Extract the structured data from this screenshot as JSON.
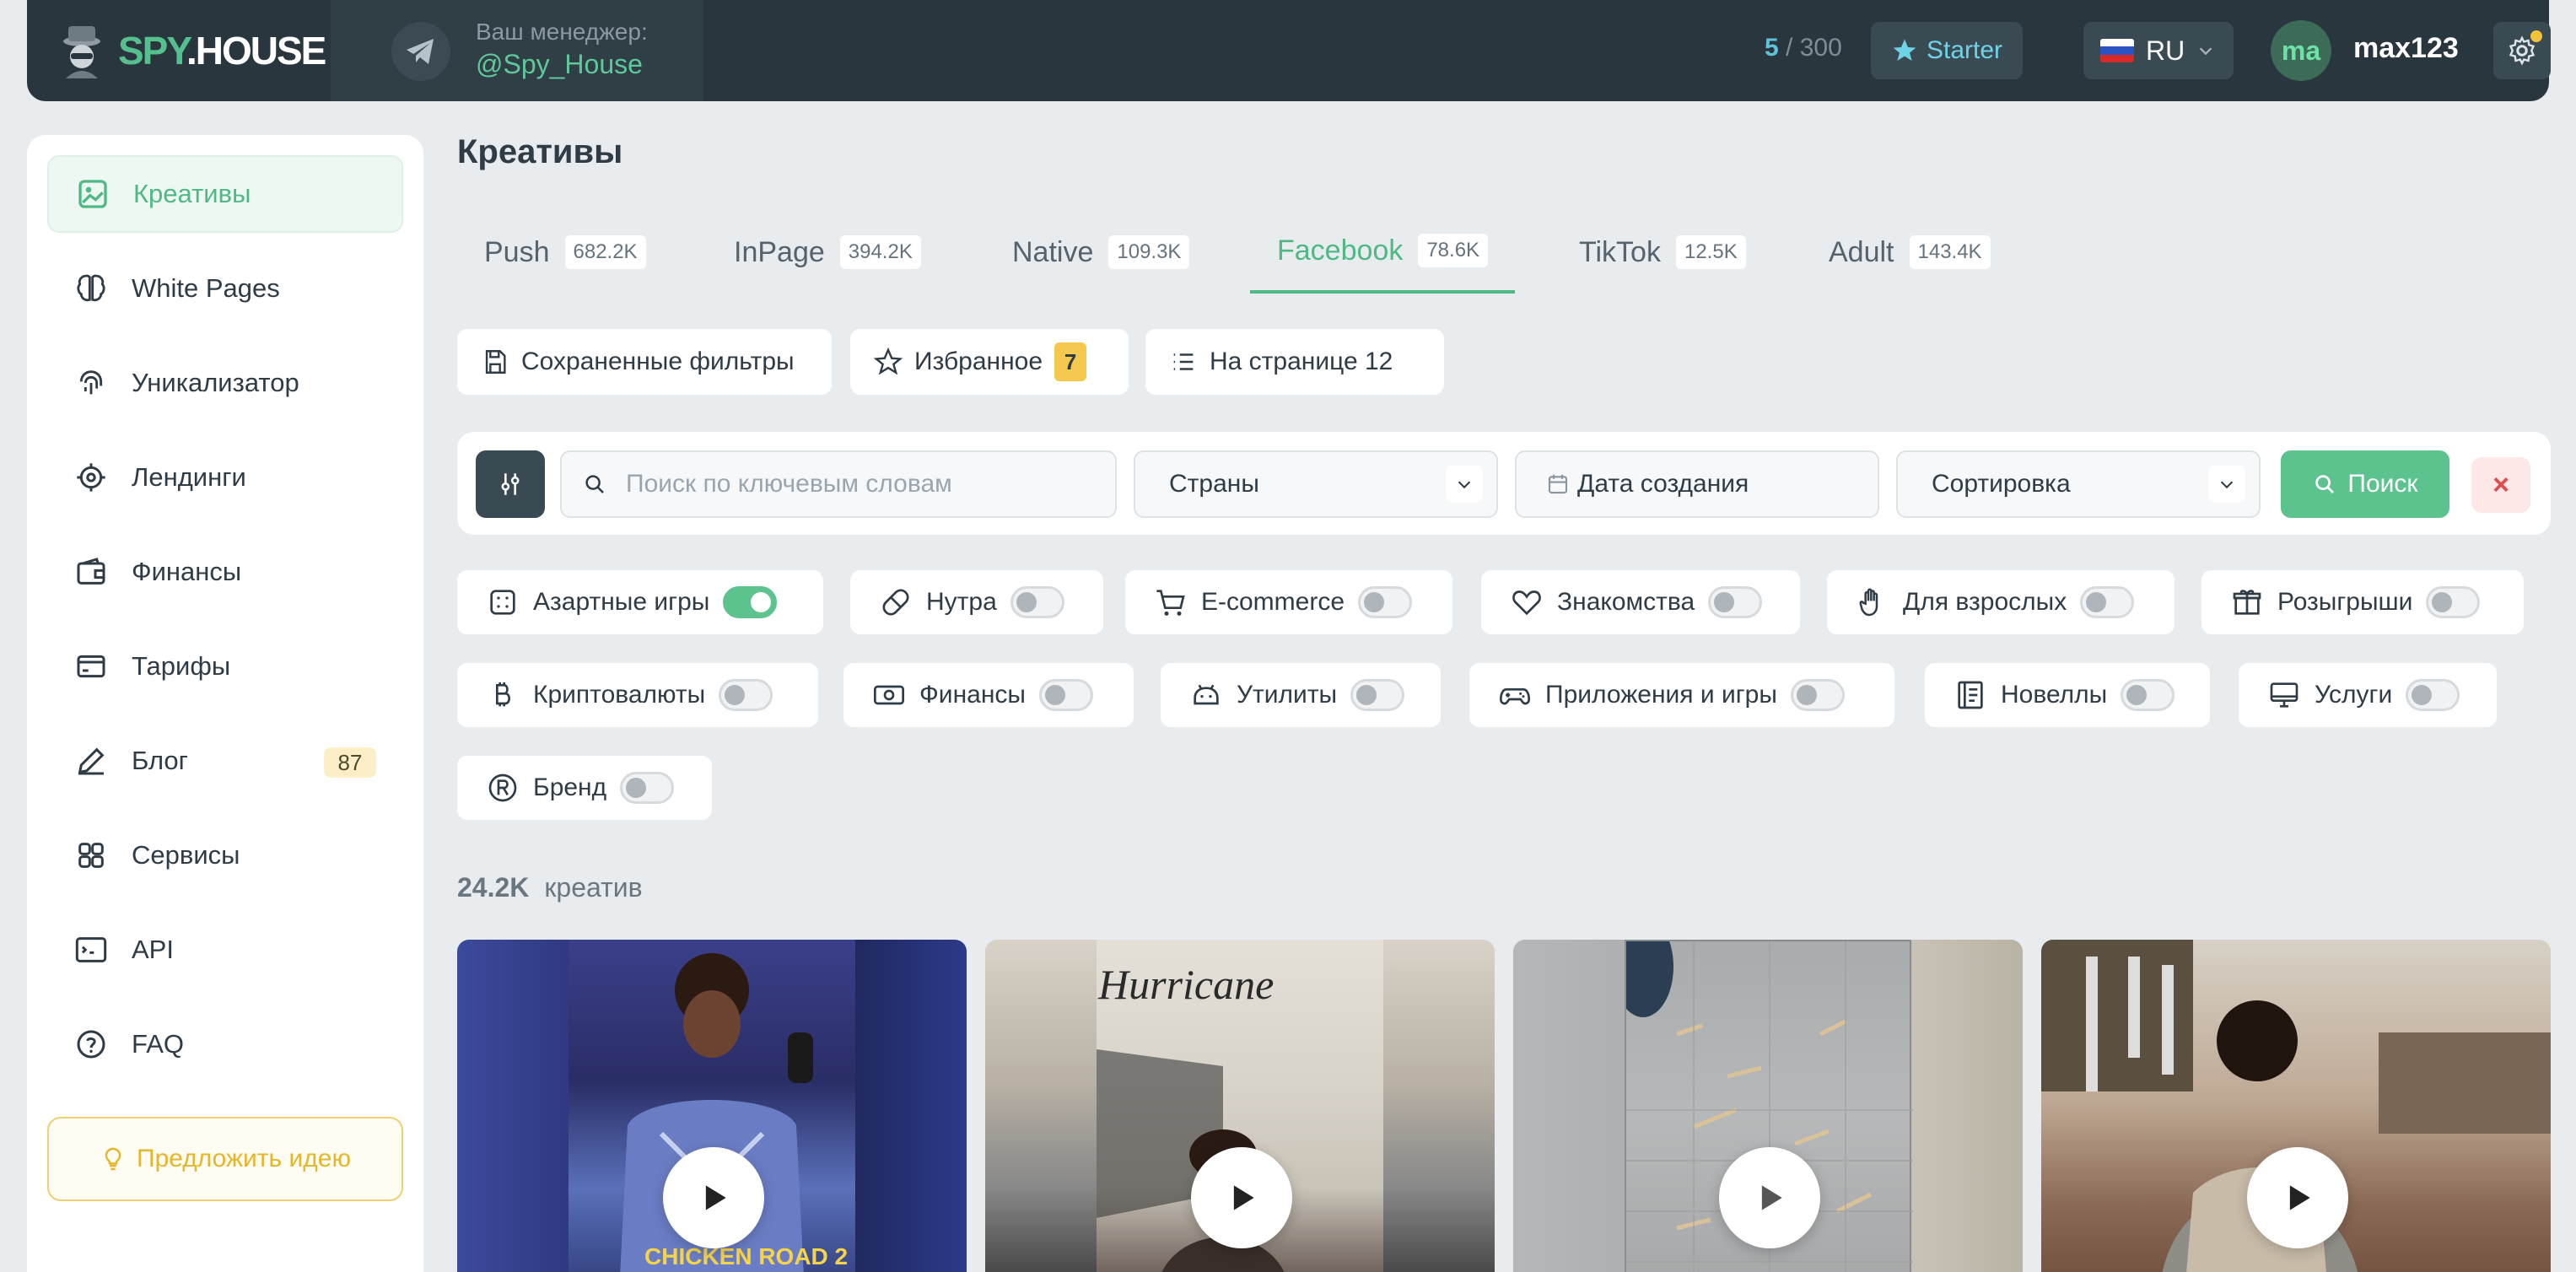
{
  "header": {
    "logo_text_accent": "SPY",
    "logo_text_rest": ".HOUSE",
    "manager_label": "Ваш менеджер:",
    "manager_handle": "@Spy_House",
    "counter_used": "5",
    "counter_total": "/ 300",
    "plan_label": "Starter",
    "language": "RU",
    "avatar_initials": "ma",
    "username": "max123"
  },
  "sidebar": {
    "items": [
      {
        "label": "Креативы",
        "icon": "image-icon"
      },
      {
        "label": "White Pages",
        "icon": "brain-icon"
      },
      {
        "label": "Уникализатор",
        "icon": "fingerprint-icon"
      },
      {
        "label": "Лендинги",
        "icon": "target-icon"
      },
      {
        "label": "Финансы",
        "icon": "wallet-icon"
      },
      {
        "label": "Тарифы",
        "icon": "card-icon"
      },
      {
        "label": "Блог",
        "icon": "pen-icon",
        "badge": "87"
      },
      {
        "label": "Сервисы",
        "icon": "grid-icon"
      },
      {
        "label": "API",
        "icon": "api-icon"
      },
      {
        "label": "FAQ",
        "icon": "question-icon"
      }
    ],
    "idea_button": "Предложить идею"
  },
  "main": {
    "title": "Креативы",
    "tabs": [
      {
        "label": "Push",
        "count": "682.2K"
      },
      {
        "label": "InPage",
        "count": "394.2K"
      },
      {
        "label": "Native",
        "count": "109.3K"
      },
      {
        "label": "Facebook",
        "count": "78.6K"
      },
      {
        "label": "TikTok",
        "count": "12.5K"
      },
      {
        "label": "Adult",
        "count": "143.4K"
      }
    ],
    "active_tab": "Facebook",
    "saved_filters": "Сохраненные фильтры",
    "favorites": "Избранное",
    "favorites_count": "7",
    "per_page": "На странице 12",
    "search_placeholder": "Поиск по ключевым словам",
    "countries": "Страны",
    "date_created": "Дата создания",
    "sorting": "Сортировка",
    "search_button": "Поиск",
    "categories": [
      {
        "label": "Азартные игры",
        "on": true
      },
      {
        "label": "Нутра",
        "on": false
      },
      {
        "label": "E-commerce",
        "on": false
      },
      {
        "label": "Знакомства",
        "on": false
      },
      {
        "label": "Для взрослых",
        "on": false
      },
      {
        "label": "Розыгрыши",
        "on": false
      },
      {
        "label": "Криптовалюты",
        "on": false
      },
      {
        "label": "Финансы",
        "on": false
      },
      {
        "label": "Утилиты",
        "on": false
      },
      {
        "label": "Приложения и игры",
        "on": false
      },
      {
        "label": "Новеллы",
        "on": false
      },
      {
        "label": "Услуги",
        "on": false
      },
      {
        "label": "Бренд",
        "on": false
      }
    ],
    "result_count": "24.2K",
    "result_label": "креатив",
    "card_texts": [
      "CHICKEN ROAD 2",
      "Hurricane"
    ]
  },
  "colors": {
    "accent": "#4fb884",
    "header_bg": "#2a363e",
    "favorites_badge": "#f5c94f",
    "page_bg": "#e8ecef"
  }
}
